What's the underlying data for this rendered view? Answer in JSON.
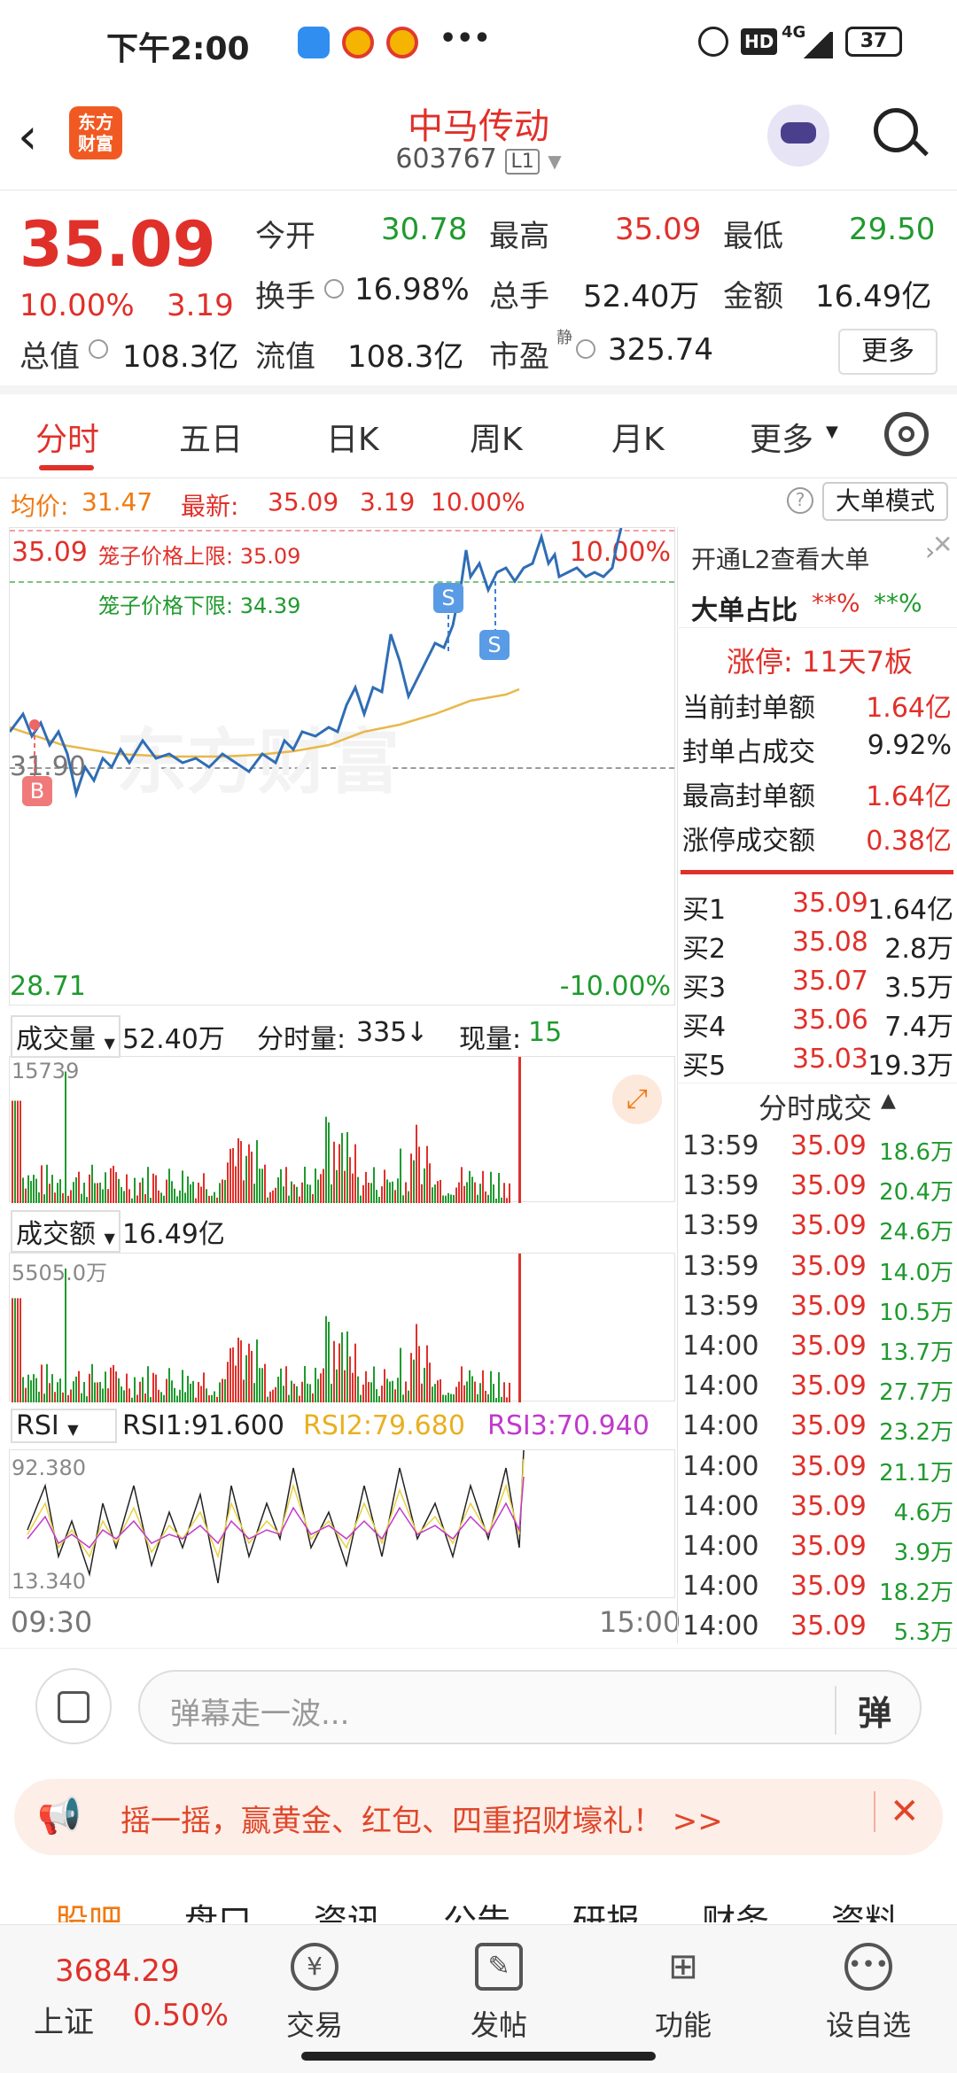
{
  "status": {
    "time": "下午2:00",
    "network": "4G",
    "battery": "37",
    "hd": "HD",
    "more": "•••"
  },
  "header": {
    "logo_line1": "东方",
    "logo_line2": "财富",
    "title": "中马传动",
    "code": "603767",
    "level": "L1"
  },
  "quote": {
    "price": "35.09",
    "pct": "10.00%",
    "chg": "3.19",
    "open_label": "今开",
    "open": "30.78",
    "high_label": "最高",
    "high": "35.09",
    "low_label": "最低",
    "low": "29.50",
    "turnover_label": "换手",
    "turnover": "16.98%",
    "volume_label": "总手",
    "volume": "52.40万",
    "amount_label": "金额",
    "amount": "16.49亿",
    "mcap_label": "总值",
    "mcap": "108.3亿",
    "float_label": "流值",
    "float": "108.3亿",
    "pe_label": "市盈",
    "pe_sup": "静",
    "pe": "325.74",
    "more_button": "更多"
  },
  "tabs": [
    {
      "label": "分时",
      "active": true
    },
    {
      "label": "五日"
    },
    {
      "label": "日K"
    },
    {
      "label": "周K"
    },
    {
      "label": "月K"
    },
    {
      "label": "更多"
    }
  ],
  "infoline": {
    "avg_label": "均价:",
    "avg": "31.47",
    "last_label": "最新:",
    "last": "35.09",
    "chg": "3.19",
    "pct": "10.00%",
    "mode_button": "大单模式",
    "help": "?"
  },
  "chart": {
    "price_top": "35.09",
    "pct_top": "10.00%",
    "upper_limit": "笼子价格上限: 35.09",
    "lower_limit": "笼子价格下限: 34.39",
    "mid_price": "31.90",
    "price_bottom": "28.71",
    "pct_bottom": "-10.00%",
    "watermark": "东方财富",
    "marker_b": "B",
    "marker_s": "S",
    "vol_label": "成交量",
    "vol_total": "52.40万",
    "vol_min_label": "分时量:",
    "vol_min": "335",
    "vol_now_label": "现量:",
    "vol_now": "15",
    "vol_max": "15739",
    "amt_label": "成交额",
    "amt_total": "16.49亿",
    "amt_max": "5505.0万",
    "rsi_label": "RSI",
    "rsi1": "RSI1:91.600",
    "rsi2": "RSI2:79.680",
    "rsi3": "RSI3:70.940",
    "rsi_max": "92.380",
    "rsi_min": "13.340",
    "time_start": "09:30",
    "time_end": "15:00"
  },
  "right": {
    "l2_link": "开通L2查看大单",
    "big_order_label": "大单占比",
    "big_buy": "**%",
    "big_sell": "**%",
    "limit_up": "涨停: 11天7板",
    "rows": [
      {
        "label": "当前封单额",
        "value": "1.64亿"
      },
      {
        "label": "封单占成交",
        "value": "9.92%"
      },
      {
        "label": "最高封单额",
        "value": "1.64亿"
      },
      {
        "label": "涨停成交额",
        "value": "0.38亿"
      }
    ],
    "bids": [
      {
        "label": "买1",
        "price": "35.09",
        "vol": "1.64亿"
      },
      {
        "label": "买2",
        "price": "35.08",
        "vol": "2.8万"
      },
      {
        "label": "买3",
        "price": "35.07",
        "vol": "3.5万"
      },
      {
        "label": "买4",
        "price": "35.06",
        "vol": "7.4万"
      },
      {
        "label": "买5",
        "price": "35.03",
        "vol": "19.3万"
      }
    ],
    "ticks_title": "分时成交",
    "ticks": [
      {
        "t": "13:59",
        "p": "35.09",
        "v": "18.6万"
      },
      {
        "t": "13:59",
        "p": "35.09",
        "v": "20.4万"
      },
      {
        "t": "13:59",
        "p": "35.09",
        "v": "24.6万"
      },
      {
        "t": "13:59",
        "p": "35.09",
        "v": "14.0万"
      },
      {
        "t": "13:59",
        "p": "35.09",
        "v": "10.5万"
      },
      {
        "t": "14:00",
        "p": "35.09",
        "v": "13.7万"
      },
      {
        "t": "14:00",
        "p": "35.09",
        "v": "27.7万"
      },
      {
        "t": "14:00",
        "p": "35.09",
        "v": "23.2万"
      },
      {
        "t": "14:00",
        "p": "35.09",
        "v": "21.1万"
      },
      {
        "t": "14:00",
        "p": "35.09",
        "v": "4.6万"
      },
      {
        "t": "14:00",
        "p": "35.09",
        "v": "3.9万"
      },
      {
        "t": "14:00",
        "p": "35.09",
        "v": "18.2万"
      },
      {
        "t": "14:00",
        "p": "35.09",
        "v": "5.3万"
      }
    ]
  },
  "comment": {
    "placeholder": "弹幕走一波...",
    "danmu_button": "弹"
  },
  "banner": {
    "text": "摇一摇，赢黄金、红包、四重招财壕礼！ >>"
  },
  "subtabs": [
    "股吧",
    "盘口",
    "资讯",
    "公告",
    "研报",
    "财务",
    "资料"
  ],
  "bottom": {
    "index_value": "3684.29",
    "index_name": "上证",
    "index_pct": "0.50%",
    "nav": [
      {
        "label": "交易",
        "icon": "trade-icon"
      },
      {
        "label": "发帖",
        "icon": "post-icon"
      },
      {
        "label": "功能",
        "icon": "apps-icon"
      },
      {
        "label": "设自选",
        "icon": "watchlist-icon"
      }
    ]
  }
}
